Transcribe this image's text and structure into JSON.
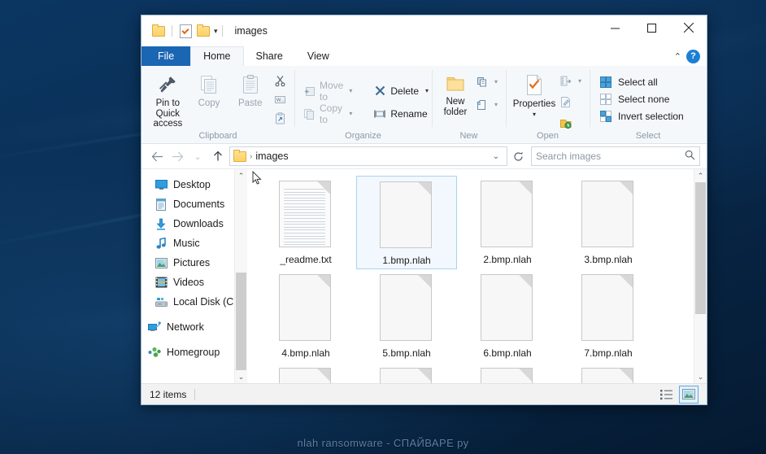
{
  "desktop": {
    "watermark": "nlah ransomware - СПАЙВАРЕ ру"
  },
  "window": {
    "title": "images",
    "quick_access": {
      "folder_icon": "folder-icon",
      "properties_icon": "properties-icon",
      "folder2_icon": "folder-icon",
      "customize_caret": "▾"
    },
    "controls": {
      "minimize": "minimize-icon",
      "maximize": "maximize-icon",
      "close": "close-icon"
    }
  },
  "ribbon": {
    "tabs": [
      {
        "label": "File",
        "state": "file"
      },
      {
        "label": "Home",
        "state": "active"
      },
      {
        "label": "Share",
        "state": "normal"
      },
      {
        "label": "View",
        "state": "normal"
      }
    ],
    "collapse_caret": "⌃",
    "help_label": "?",
    "groups": [
      {
        "name": "Clipboard",
        "label": "Clipboard",
        "big_buttons": [
          {
            "label": "Pin to Quick access",
            "icon": "pin-icon",
            "enabled": true
          },
          {
            "label": "Copy",
            "icon": "copy-icon",
            "enabled": false
          },
          {
            "label": "Paste",
            "icon": "paste-icon",
            "enabled": false
          }
        ],
        "small_buttons": [
          {
            "label": "",
            "icon": "cut-icon"
          },
          {
            "label": "",
            "icon": "copy-path-icon"
          },
          {
            "label": "",
            "icon": "paste-shortcut-icon"
          }
        ]
      },
      {
        "name": "Organize",
        "label": "Organize",
        "items": [
          {
            "label": "Move to",
            "icon": "move-to-icon",
            "caret": "▾",
            "enabled": false
          },
          {
            "label": "Copy to",
            "icon": "copy-to-icon",
            "caret": "▾",
            "enabled": false
          },
          {
            "label": "Delete",
            "icon": "delete-icon",
            "caret": "▾",
            "enabled": true
          },
          {
            "label": "Rename",
            "icon": "rename-icon",
            "caret": "",
            "enabled": true
          }
        ]
      },
      {
        "name": "New",
        "label": "New",
        "big_buttons": [
          {
            "label": "New folder",
            "icon": "new-folder-icon",
            "enabled": true
          }
        ],
        "small_buttons": [
          {
            "label": "",
            "icon": "new-item-icon",
            "caret": "▾"
          },
          {
            "label": "",
            "icon": "easy-access-icon",
            "caret": "▾"
          }
        ]
      },
      {
        "name": "Open",
        "label": "Open",
        "big_buttons": [
          {
            "label": "Properties",
            "icon": "properties-icon",
            "caret": "▾",
            "enabled": true
          }
        ],
        "small_buttons": [
          {
            "label": "",
            "icon": "open-icon",
            "caret": "▾"
          },
          {
            "label": "",
            "icon": "edit-icon",
            "caret": ""
          },
          {
            "label": "",
            "icon": "history-icon",
            "caret": ""
          }
        ]
      },
      {
        "name": "Select",
        "label": "Select",
        "items": [
          {
            "label": "Select all",
            "icon": "select-all-icon"
          },
          {
            "label": "Select none",
            "icon": "select-none-icon"
          },
          {
            "label": "Invert selection",
            "icon": "invert-selection-icon"
          }
        ]
      }
    ]
  },
  "addressbar": {
    "back_icon": "back-arrow-icon",
    "forward_icon": "forward-arrow-icon",
    "recent_caret": "⌄",
    "up_icon": "up-arrow-icon",
    "path_folder_icon": "folder-icon",
    "path_separator": "›",
    "crumb": "images",
    "dropdown_caret": "⌄",
    "refresh_icon": "refresh-icon",
    "search_placeholder": "Search images",
    "search_value": "",
    "search_icon": "search-icon"
  },
  "sidebar": {
    "items": [
      {
        "label": "Desktop",
        "icon": "desktop-icon",
        "level": "child"
      },
      {
        "label": "Documents",
        "icon": "documents-icon",
        "level": "child"
      },
      {
        "label": "Downloads",
        "icon": "downloads-icon",
        "level": "child"
      },
      {
        "label": "Music",
        "icon": "music-icon",
        "level": "child"
      },
      {
        "label": "Pictures",
        "icon": "pictures-icon",
        "level": "child"
      },
      {
        "label": "Videos",
        "icon": "videos-icon",
        "level": "child"
      },
      {
        "label": "Local Disk (C:)",
        "icon": "disk-icon",
        "level": "child"
      },
      {
        "label": "Network",
        "icon": "network-icon",
        "level": "root"
      },
      {
        "label": "Homegroup",
        "icon": "homegroup-icon",
        "level": "root"
      }
    ]
  },
  "files": {
    "rows": [
      [
        {
          "name": "_readme.txt",
          "type": "text",
          "selected": false
        },
        {
          "name": "1.bmp.nlah",
          "type": "blank",
          "selected": true
        },
        {
          "name": "2.bmp.nlah",
          "type": "blank",
          "selected": false
        },
        {
          "name": "3.bmp.nlah",
          "type": "blank",
          "selected": false
        }
      ],
      [
        {
          "name": "4.bmp.nlah",
          "type": "blank",
          "selected": false
        },
        {
          "name": "5.bmp.nlah",
          "type": "blank",
          "selected": false
        },
        {
          "name": "6.bmp.nlah",
          "type": "blank",
          "selected": false
        },
        {
          "name": "7.bmp.nlah",
          "type": "blank",
          "selected": false
        }
      ],
      [
        {
          "name": "",
          "type": "blank",
          "selected": false
        },
        {
          "name": "",
          "type": "blank",
          "selected": false
        },
        {
          "name": "",
          "type": "blank",
          "selected": false
        },
        {
          "name": "",
          "type": "blank",
          "selected": false
        }
      ]
    ]
  },
  "statusbar": {
    "item_count": "12 items",
    "details_view_icon": "details-view-icon",
    "icons_view_icon": "large-icons-view-icon",
    "active_view": "large-icons"
  },
  "colors": {
    "accent": "#1b66b3",
    "selection_border": "#a9d4f2",
    "selection_fill": "#f2f8fd",
    "ribbon_bg": "#f5f8fb",
    "folder_yellow": "#fdd166"
  }
}
